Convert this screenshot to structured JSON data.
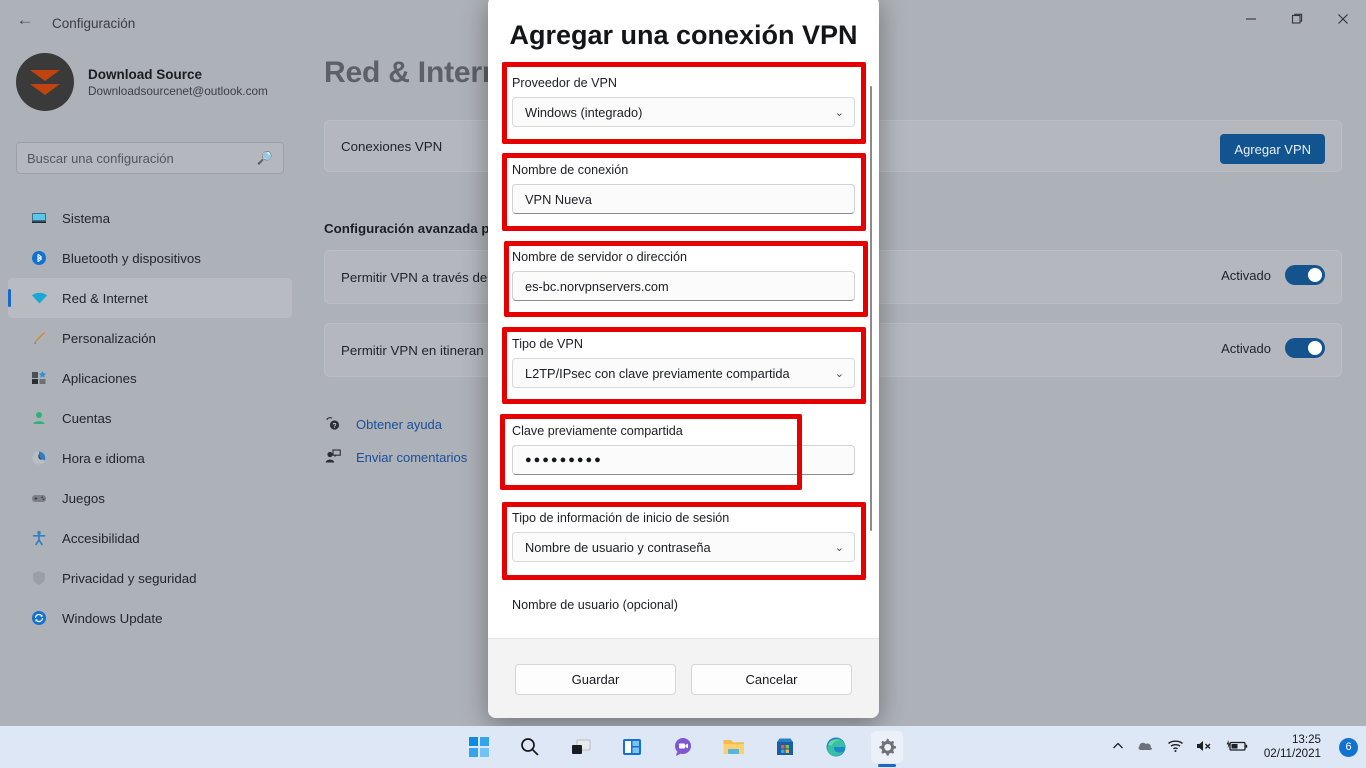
{
  "window": {
    "title": "Configuración",
    "back_icon": "back-arrow-icon",
    "minimize": "—",
    "maximize": "❐",
    "close": "✕"
  },
  "sidebar": {
    "account": {
      "name": "Download Source",
      "email": "Downloadsourcenet@outlook.com"
    },
    "search": {
      "placeholder": "Buscar una configuración",
      "icon": "search-icon"
    },
    "items": [
      {
        "label": "Sistema",
        "icon": "monitor-icon",
        "selected": false
      },
      {
        "label": "Bluetooth y dispositivos",
        "icon": "bluetooth-icon",
        "selected": false
      },
      {
        "label": "Red & Internet",
        "icon": "wifi-icon",
        "selected": true
      },
      {
        "label": "Personalización",
        "icon": "brush-icon",
        "selected": false
      },
      {
        "label": "Aplicaciones",
        "icon": "apps-icon",
        "selected": false
      },
      {
        "label": "Cuentas",
        "icon": "person-icon",
        "selected": false
      },
      {
        "label": "Hora e idioma",
        "icon": "clock-icon",
        "selected": false
      },
      {
        "label": "Juegos",
        "icon": "gamepad-icon",
        "selected": false
      },
      {
        "label": "Accesibilidad",
        "icon": "accessibility-icon",
        "selected": false
      },
      {
        "label": "Privacidad y seguridad",
        "icon": "shield-icon",
        "selected": false
      },
      {
        "label": "Windows Update",
        "icon": "update-icon",
        "selected": false
      }
    ]
  },
  "main": {
    "page_title": "Red & Internet",
    "vpn_card": {
      "label": "Conexiones VPN",
      "button": "Agregar VPN"
    },
    "section_heading": "Configuración avanzada p",
    "rows": [
      {
        "label": "Permitir VPN a través de",
        "state": "Activado"
      },
      {
        "label": "Permitir VPN en itineran",
        "state": "Activado"
      }
    ],
    "links": [
      {
        "label": "Obtener ayuda",
        "icon": "help-icon"
      },
      {
        "label": "Enviar comentarios",
        "icon": "feedback-icon"
      }
    ]
  },
  "dialog": {
    "title": "Agregar una conexión VPN",
    "fields": [
      {
        "label": "Proveedor de VPN",
        "value": "Windows (integrado)",
        "type": "select",
        "highlighted": true
      },
      {
        "label": "Nombre de conexión",
        "value": "VPN Nueva",
        "type": "text",
        "highlighted": true
      },
      {
        "label": "Nombre de servidor o dirección",
        "value": "es-bc.norvpnservers.com",
        "type": "text",
        "highlighted": true
      },
      {
        "label": "Tipo de VPN",
        "value": "L2TP/IPsec con clave previamente compartida",
        "type": "select",
        "highlighted": true
      },
      {
        "label": "Clave previamente compartida",
        "value": "●●●●●●●●●",
        "type": "password",
        "highlighted": true
      },
      {
        "label": "Tipo de información de inicio de sesión",
        "value": "Nombre de usuario y contraseña",
        "type": "select",
        "highlighted": true
      },
      {
        "label": "Nombre de usuario (opcional)",
        "value": "",
        "type": "label-only",
        "highlighted": false
      }
    ],
    "save_label": "Guardar",
    "cancel_label": "Cancelar",
    "caret_icon": "chevron-down-icon"
  },
  "taskbar": {
    "items": [
      {
        "name": "start-icon"
      },
      {
        "name": "search-icon"
      },
      {
        "name": "task-view-icon"
      },
      {
        "name": "widgets-icon"
      },
      {
        "name": "chat-icon"
      },
      {
        "name": "file-explorer-icon"
      },
      {
        "name": "microsoft-store-icon"
      },
      {
        "name": "edge-icon"
      },
      {
        "name": "settings-icon"
      }
    ],
    "tray": {
      "overflow": "^",
      "cloud": "cloud-icon",
      "wifi": "wifi-icon",
      "volume": "volume-mute-icon",
      "battery": "battery-charging-icon",
      "time": "13:25",
      "date": "02/11/2021",
      "notification_count": "6"
    }
  },
  "colors": {
    "accent": "#11548f",
    "highlight": "#e60000",
    "link": "#1b4e9b",
    "taskbar": "#dee7f5",
    "desktop": "#adb1b8"
  }
}
